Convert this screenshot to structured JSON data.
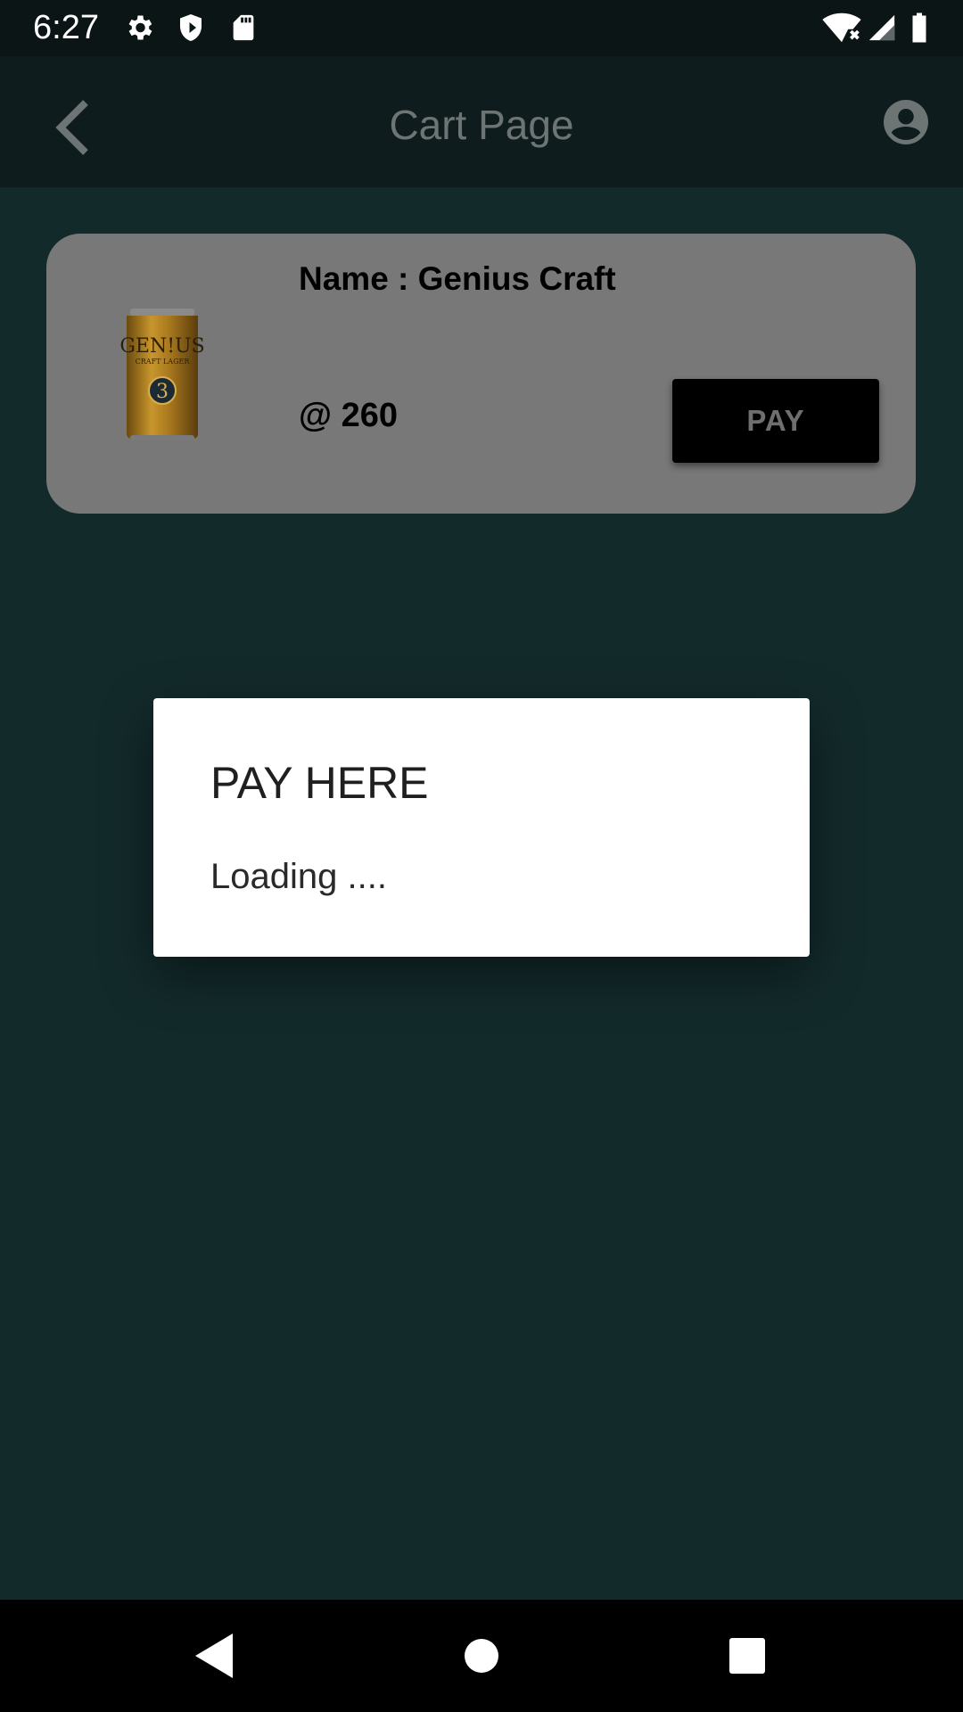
{
  "status_bar": {
    "time": "6:27",
    "icons": [
      "settings-icon",
      "shield-icon",
      "sd-card-icon",
      "wifi-icon",
      "signal-icon",
      "battery-icon"
    ]
  },
  "app_bar": {
    "title": "Cart Page",
    "back_icon": "chevron-left-icon",
    "profile_icon": "account-circle-icon"
  },
  "cart": {
    "items": [
      {
        "name_label": "Name : Genius Craft",
        "price_label": "@ 260",
        "pay_label": "PAY",
        "image_text": "GEN!US",
        "image_subtext": "CRAFT LAGER",
        "image_badge": "3"
      }
    ]
  },
  "dialog": {
    "title": "PAY HERE",
    "message": "Loading ...."
  },
  "nav_bar": {
    "icons": [
      "back-triangle-icon",
      "home-circle-icon",
      "recents-square-icon"
    ]
  },
  "colors": {
    "status_bar": "#0b1516",
    "app_bar": "#0f1c1d",
    "background": "#132a2b",
    "card": "#787878",
    "pay_button": "#000000",
    "dialog": "#ffffff"
  }
}
